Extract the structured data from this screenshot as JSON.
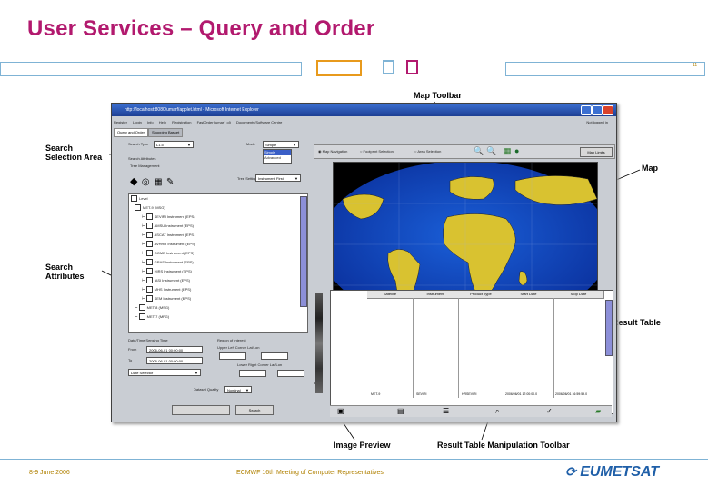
{
  "slide": {
    "title": "User Services – Query and Order",
    "page_marker": "11",
    "footer_date": "8-9 June 2006",
    "footer_event": "ECMWF 16th Meeting of Computer Representatives",
    "logo_text": "EUMETSAT",
    "title_color": "#b2196e"
  },
  "callouts": {
    "map_toolbar": "Map Toolbar",
    "search_selection_area": "Search Selection Area",
    "map": "Map",
    "search_attributes": "Search Attributes",
    "result_table": "Result Table",
    "image_preview": "Image Preview",
    "result_table_toolbar": "Result Table Manipulation Toolbar"
  },
  "window": {
    "title": "http://localhost:8080/umarf/applet.html - Microsoft Internet Explorer",
    "menus": [
      "Register",
      "Login",
      "Info",
      "Help",
      "Registration",
      "FastOrder (umarf_ol)",
      "Documents/Software Centre"
    ],
    "menu_right": "Not logged in",
    "tabs": [
      "Query and Order",
      "Shopping Basket"
    ]
  },
  "search": {
    "type_label": "Search Type",
    "type_value": "L1.5",
    "mode_label": "Mode",
    "mode_value": "Simple",
    "mode_options": [
      "Simple",
      "Advanced"
    ],
    "attributes_label": "Search Attributes",
    "tree_header": "Tree Management",
    "tree_setting_label": "Tree Setting",
    "tree_setting_value": "Instrument First"
  },
  "tree_items": [
    "Level",
    "MET-9 (MSG)",
    "SEVIRI Instrument (EPS)",
    "AMSU Instrument (EPS)",
    "ASCAT Instrument (EPS)",
    "AVHRR Instrument (EPS)",
    "GOME Instrument (EPS)",
    "GRAS Instrument (EPS)",
    "HIRS Instrument (EPS)",
    "IASI Instrument (EPS)",
    "MHS Instrument (EPS)",
    "SEM Instrument (EPS)",
    "MET-8 (MSG)",
    "MET-7 (MFG)"
  ],
  "filters": {
    "date_range_label": "Date/Time Sensing Time",
    "from_label": "From",
    "to_label": "To",
    "from_value": "2006-06-01 00:00:00",
    "to_value": "2006-06-01 00:00:00",
    "region_label": "Region of Interest",
    "upper_left_label": "Upper Left Corner Lat/Lon",
    "lower_right_label": "Lower Right Corner Lat/Lon",
    "date_selector": "Date Selector",
    "quality_label": "Dataset Quality",
    "quality_value": "Nominal",
    "search_button": "Search"
  },
  "map_toolbar": {
    "options": [
      "Map Navigation",
      "Footprint Selection",
      "Area Selection"
    ],
    "map_limits_button": "Map Limits"
  },
  "result_table": {
    "columns": [
      "Satellite",
      "Instrument",
      "Product Type",
      "Start Date",
      "Stop Date"
    ],
    "row": [
      "MET-9",
      "SEVIRI",
      "HRSEVIRI",
      "2006/06/01 17:00:00.0",
      "2006/06/01 16:59:59.0"
    ],
    "row_index": "3"
  }
}
